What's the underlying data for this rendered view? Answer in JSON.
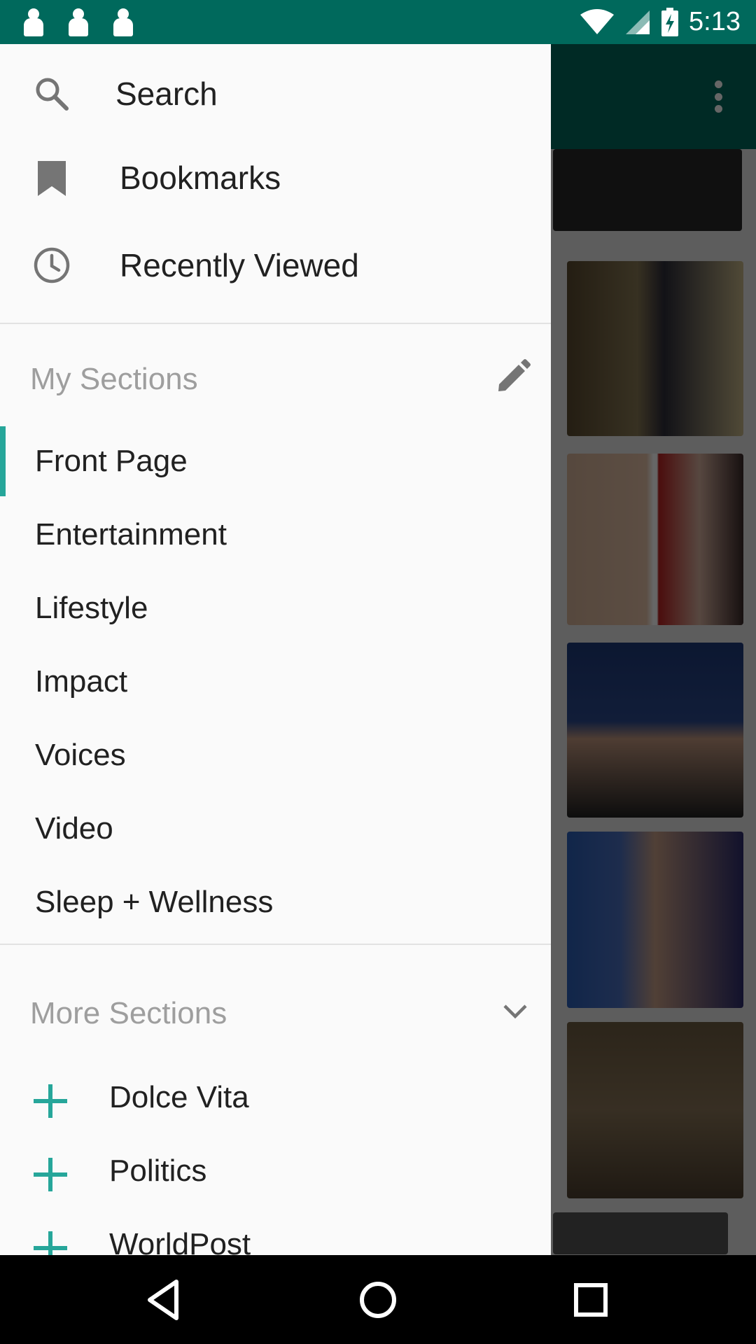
{
  "status_bar": {
    "time": "5:13",
    "notification_icons": [
      "notification-icon",
      "notification-icon",
      "notification-icon"
    ],
    "system_icons": [
      "wifi-icon",
      "signal-icon",
      "battery-charging-icon"
    ]
  },
  "background_app": {
    "toolbar_menu_icon": "more-vert-icon",
    "accent": "#00695c"
  },
  "drawer": {
    "top_items": [
      {
        "icon": "search-icon",
        "label": "Search"
      },
      {
        "icon": "bookmark-icon",
        "label": "Bookmarks"
      },
      {
        "icon": "clock-icon",
        "label": "Recently Viewed"
      }
    ],
    "my_sections": {
      "header": "My Sections",
      "edit_icon": "pencil-icon",
      "items": [
        "Front Page",
        "Entertainment",
        "Lifestyle",
        "Impact",
        "Voices",
        "Video",
        "Sleep + Wellness"
      ],
      "active_index": 0
    },
    "more_sections": {
      "header": "More Sections",
      "expand_icon": "chevron-down-icon",
      "items": [
        "Dolce Vita",
        "Politics",
        "WorldPost"
      ]
    },
    "accent_color": "#26a69a"
  },
  "nav_bar": {
    "buttons": [
      "back-icon",
      "home-icon",
      "recents-icon"
    ]
  }
}
